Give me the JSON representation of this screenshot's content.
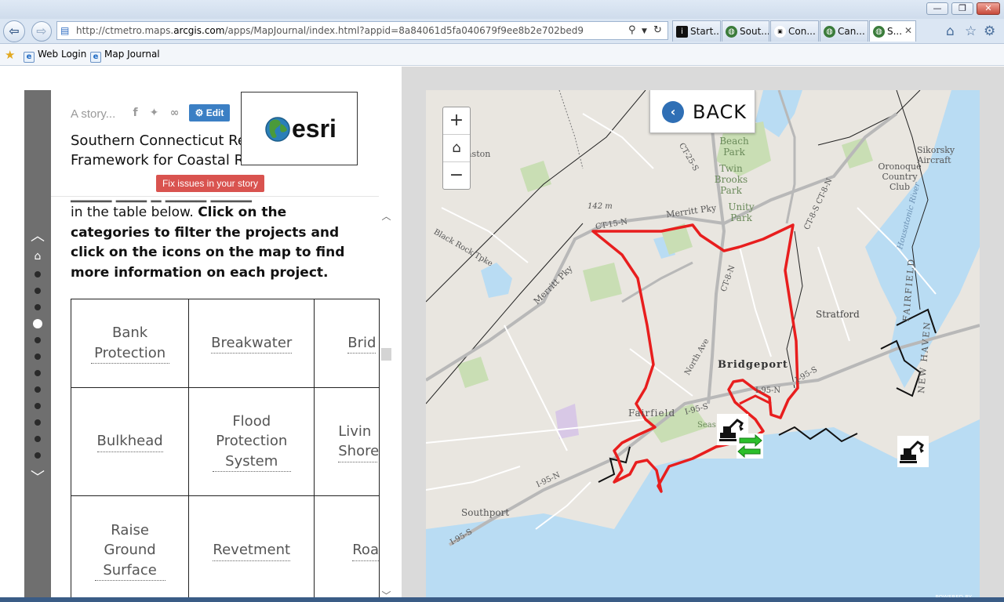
{
  "browser": {
    "url_prefix": "http://ctmetro.maps.",
    "url_domain": "arcgis.com",
    "url_suffix": "/apps/MapJournal/index.html?appid=8a84061d5fa040679f9ee8b2e702bed9",
    "tabs": [
      {
        "label": "Start..."
      },
      {
        "label": "Sout..."
      },
      {
        "label": "Con..."
      },
      {
        "label": "Can..."
      },
      {
        "label": "S...",
        "close": "✕"
      }
    ],
    "window_buttons": {
      "minimize": "—",
      "maximize": "❐",
      "close": "✕"
    }
  },
  "favorites": {
    "items": [
      {
        "label": "Web Login"
      },
      {
        "label": "Map Journal"
      }
    ]
  },
  "story": {
    "tagline": "A story...",
    "edit_label": "Edit",
    "title": "Southern Connecticut Regional Framework for Coastal Resilience",
    "fix_label": "Fix issues in your story",
    "intro_plain": "in the table below. ",
    "intro_bold": "Click on the categories to filter the projects and click on the icons on the map to find more information on each project."
  },
  "categories": {
    "rows": [
      [
        "Bank Protection",
        "Breakwater",
        "Brid"
      ],
      [
        "Bulkhead",
        "Flood Protection System",
        "Livin Shore"
      ],
      [
        "Raise Ground Surface",
        "Revetment",
        "Roa"
      ]
    ]
  },
  "map": {
    "back_label": "BACK",
    "zoom_in": "+",
    "zoom_out": "−",
    "powered_by": "POWERED BY",
    "labels": {
      "bridgeport": "Bridgeport",
      "stratford": "Stratford",
      "fairfield": "Fairfield",
      "southport": "Southport",
      "beach_park": "Beach Park",
      "twin_brooks": "Twin Brooks Park",
      "unity_park": "Unity Park",
      "sikorsky": "Sikorsky Aircraft",
      "oronoque": "Oronoque Country Club",
      "merritt_pky": "Merritt Pky",
      "merritt_pky2": "Merritt Pky",
      "ct15": "CT-15-N",
      "ct8": "CT-8-N",
      "ct8b": "CT-8-S CT-8-N",
      "ct25": "CT-25-S",
      "i95n": "I-95-N",
      "i95n2": "I-95-N",
      "i95s": "I-95-S",
      "i95s2": "I-95-S",
      "i95s3": "I-95-S",
      "north_ave": "North Ave",
      "black_rock": "Black Rock Tpke",
      "elev": "142 m",
      "easton": "aston",
      "fairfield_county": "FAIRFIELD",
      "new_haven": "NEW HAVEN",
      "housatonic": "Housatonic River",
      "seaside": "Seas"
    },
    "colors": {
      "boundary": "#e81e1e",
      "water": "#b9dcf3",
      "land": "#e9e6e0",
      "park": "#c9deb4",
      "road": "#ffffff",
      "highway": "#b8b8b8"
    }
  }
}
